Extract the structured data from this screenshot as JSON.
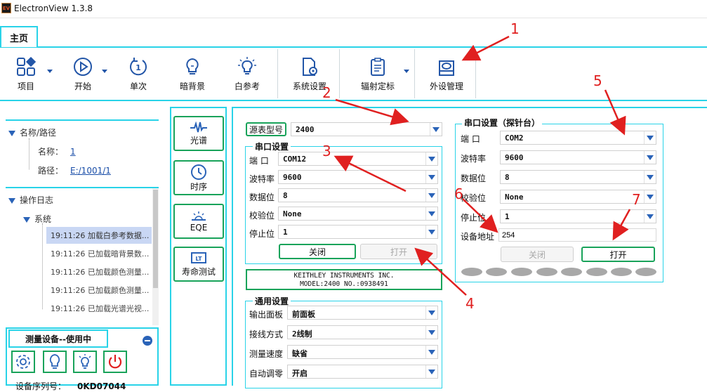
{
  "window": {
    "title": "ElectronView 1.3.8",
    "icon_text": "EV"
  },
  "ribbon": {
    "tab": "主页",
    "buttons": [
      {
        "label": "项目",
        "icon": "grid-icon"
      },
      {
        "label": "开始",
        "icon": "play-icon"
      },
      {
        "label": "单次",
        "icon": "single-icon"
      },
      {
        "label": "暗背景",
        "icon": "bulb-off-icon"
      },
      {
        "label": "白参考",
        "icon": "bulb-on-icon"
      },
      {
        "label": "系统设置",
        "icon": "settings-doc-icon"
      },
      {
        "label": "辐射定标",
        "icon": "clipboard-icon"
      },
      {
        "label": "外设管理",
        "icon": "peripheral-icon"
      }
    ]
  },
  "tree": {
    "root": "名称/路径",
    "name_label": "名称：",
    "name_value": "1",
    "path_label": "路径：",
    "path_value": "E:/1001/1"
  },
  "log": {
    "title": "操作日志",
    "group": "系统",
    "items": [
      "19:11:26 加载白参考数据...",
      "19:11:26 已加载暗背景数...",
      "19:11:26 已加载颜色测量...",
      "19:11:26 已加载颜色测量...",
      "19:11:26 已加载光谱光视..."
    ]
  },
  "device": {
    "title": "测量设备--使用中",
    "serial_label": "设备序列号：",
    "serial_value": "0KD07044"
  },
  "nav": [
    {
      "label": "光谱",
      "icon": "spectrum-icon"
    },
    {
      "label": "时序",
      "icon": "clock-icon"
    },
    {
      "label": "EQE",
      "icon": "eqe-icon"
    },
    {
      "label": "寿命测试",
      "icon": "lifetime-icon"
    }
  ],
  "source": {
    "model_label": "源表型号",
    "model_value": "2400",
    "serial_group_title": "串口设置",
    "port_label": "端 口",
    "port_value": "COM12",
    "baud_label": "波特率",
    "baud_value": "9600",
    "databits_label": "数据位",
    "databits_value": "8",
    "parity_label": "校验位",
    "parity_value": "None",
    "stopbits_label": "停止位",
    "stopbits_value": "1",
    "close_label": "关闭",
    "open_label": "打开",
    "info_line1": "KEITHLEY INSTRUMENTS INC.",
    "info_line2": "MODEL:2400 NO.:0938491"
  },
  "general": {
    "title": "通用设置",
    "panel_label": "输出面板",
    "panel_value": "前面板",
    "wiring_label": "接线方式",
    "wiring_value": "2线制",
    "speed_label": "测量速度",
    "speed_value": "缺省",
    "autozero_label": "自动调零",
    "autozero_value": "开启"
  },
  "probe": {
    "title": "串口设置（探针台）",
    "port_label": "端 口",
    "port_value": "COM2",
    "baud_label": "波特率",
    "baud_value": "9600",
    "databits_label": "数据位",
    "databits_value": "8",
    "parity_label": "校验位",
    "parity_value": "None",
    "stopbits_label": "停止位",
    "stopbits_value": "1",
    "address_label": "设备地址",
    "address_value": "254",
    "close_label": "关闭",
    "open_label": "打开"
  },
  "annotations": [
    "1",
    "2",
    "3",
    "4",
    "5",
    "6",
    "7"
  ],
  "colors": {
    "accent": "#29d3e8",
    "button_border": "#19a35a",
    "arrow": "#e02020",
    "icon_blue": "#2a63b8"
  }
}
